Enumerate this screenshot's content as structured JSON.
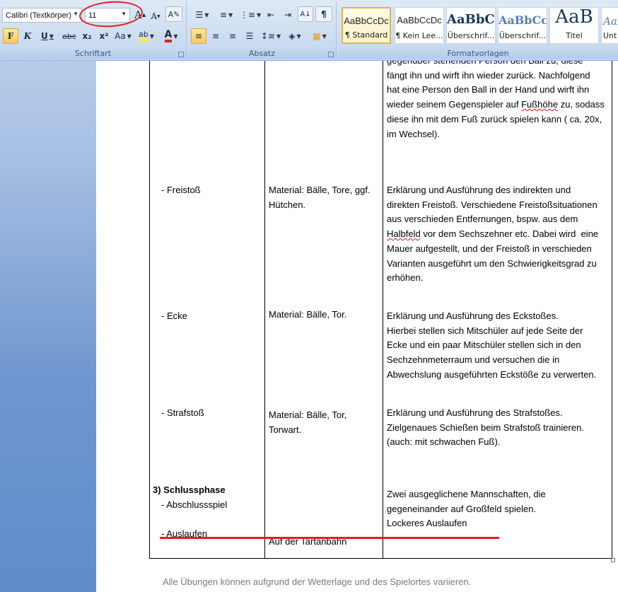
{
  "ribbon": {
    "font_group": {
      "label": "Schriftart",
      "font_name": "Calibri (Textkörper)",
      "font_size": "11",
      "grow_label": "A",
      "shrink_label": "A",
      "bold_label": "F",
      "italic_label": "K",
      "underline_label": "U",
      "strike_label": "abc",
      "subscript_label": "x₂",
      "superscript_label": "x²",
      "case_label": "Aa",
      "highlight_label": "ab",
      "font_color_label": "A"
    },
    "paragraph_group": {
      "label": "Absatz",
      "pilcrow_label": "¶"
    },
    "styles_group": {
      "label": "Formatvorlagen",
      "styles": [
        {
          "sample": "AaBbCcDc",
          "name": "¶ Standard"
        },
        {
          "sample": "AaBbCcDc",
          "name": "¶ Kein Lee..."
        },
        {
          "sample": "AaBbC(",
          "name": "Überschrif..."
        },
        {
          "sample": "AaBbCc",
          "name": "Überschrif..."
        },
        {
          "sample": "AaB",
          "name": "Titel"
        },
        {
          "sample": "AaBl",
          "name": "Unt"
        }
      ]
    }
  },
  "document": {
    "rows": [
      {
        "col1": [],
        "col2": [],
        "col3": [
          "gegenüber stehenden Person den Ball zu, diese",
          "fängt ihn und wirft ihn wieder zurück. Nachfolgend",
          "hat eine Person den Ball in der Hand und wirft ihn",
          "wieder seinem Gegenspieler auf Fußhöhe zu, sodass",
          "diese ihn mit dem Fuß zurück spielen kann ( ca. 20x,",
          "im Wechsel)."
        ]
      },
      {
        "col1": [
          "- Freistoß"
        ],
        "col2": [
          "Material: Bälle, Tore, ggf.",
          "Hütchen."
        ],
        "col3": [
          "Erklärung und Ausführung des indirekten und",
          "direkten Freistoß. Verschiedene Freistoßsituationen",
          "aus verschieden Entfernungen, bspw. aus dem",
          "Halbfeld vor dem Sechszehner etc. Dabei wird  eine",
          "Mauer aufgestellt, und der Freistoß in verschieden",
          "Varianten ausgeführt  um den Schwierigkeitsgrad zu",
          "erhöhen."
        ]
      },
      {
        "col1": [
          "- Ecke"
        ],
        "col2": [
          "Material: Bälle, Tor."
        ],
        "col3": [
          "Erklärung und Ausführung des Eckstoßes.",
          "Hierbei stellen sich Mitschüler auf jede Seite der",
          "Ecke und ein paar Mitschüler stellen sich in den",
          "Sechzehnmeterraum und versuchen die in",
          "Abwechslung ausgeführten Eckstöße zu verwerten."
        ]
      },
      {
        "col1": [
          "- Strafstoß"
        ],
        "col2": [
          "Material: Bälle, Tor,",
          "Torwart."
        ],
        "col3": [
          "Erklärung und Ausführung des Strafstoßes.",
          "Zielgenaues Schießen beim Strafstoß trainieren.",
          "(auch: mit schwachen Fuß)."
        ]
      }
    ],
    "final_section": {
      "heading": "3) Schlussphase",
      "item1": "- Abschlussspiel",
      "item2": "- Auslaufen",
      "col2": "Auf der Tartanbahn",
      "col3": [
        "Zwei ausgeglichene Mannschaften, die",
        "gegeneinander auf Großfeld spielen.",
        "Lockeres Auslaufen"
      ]
    },
    "footnote": "Alle Übungen können aufgrund der Wetterlage und des Spielortes variieren."
  },
  "colors": {
    "annotation_red": "#e02020",
    "ribbon_bg": "#cfdff1",
    "selected_style": "#e3b34b"
  }
}
